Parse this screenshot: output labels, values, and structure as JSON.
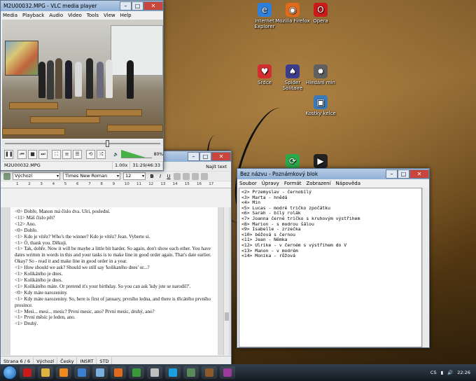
{
  "desktop": {
    "icons": [
      {
        "label": "Internet Explorer",
        "color": "#2f7fd8",
        "glyph": "e"
      },
      {
        "label": "Mozilla Firefox",
        "color": "#e06a1c",
        "glyph": "◉"
      },
      {
        "label": "Opera",
        "color": "#cc1a1a",
        "glyph": "O"
      },
      {
        "label": "Srdce",
        "color": "#d23030",
        "glyph": "♥"
      },
      {
        "label": "Spider Solitaire",
        "color": "#3c3c8c",
        "glyph": "♠"
      },
      {
        "label": "Hledání min",
        "color": "#606060",
        "glyph": "✹"
      },
      {
        "label": "Kostky kelce",
        "color": "#3a7ab8",
        "glyph": "▣"
      },
      {
        "label": "",
        "color": "#2aa84a",
        "glyph": "⟳"
      },
      {
        "label": "",
        "color": "#222222",
        "glyph": "▶"
      }
    ]
  },
  "vlc": {
    "title": "M2U00032.MPG - VLC media player",
    "menu": [
      "Media",
      "Playback",
      "Audio",
      "Video",
      "Tools",
      "View",
      "Help"
    ],
    "seek_position": 0.66,
    "volume_label": "80%",
    "volume_level": 0.8,
    "status_file": "M2U00032.MPG",
    "status_speed": "1.00x",
    "status_time": "31:29/46:33"
  },
  "writer": {
    "find_label": "Najít text",
    "paragraph_style": "Výchozí",
    "font_name": "Times New Roman",
    "font_size": "12",
    "ruler_marks": [
      "1",
      "2",
      "3",
      "4",
      "5",
      "6",
      "7",
      "8",
      "9",
      "10",
      "11",
      "12",
      "13",
      "14",
      "15",
      "16",
      "17"
    ],
    "lines": [
      "<0> Dobře, Manon má číslo dva. Ulri, poslední.",
      "<11> Máš číslo pět?",
      "<12> Ano.",
      "<0> Dobře.",
      "<1> Kdo je vítěz? Who's the winner? Kdo je vítěz? Jean. Vyberte si.",
      "<1> Ó, thank you. Děkuji.",
      "<1> Tak, dobře. Now it will be maybe a little bit harder. So again, don't show each other. You have dates written in words in this and your tasks is to make line in good order again. That's date earlier. Okay? So - read it and make line in good order in a year.",
      "<1> How should we ask? Should we still say 'kolikatého dnes' or...?",
      "<1> Kolikátého je dnes.",
      "<1> Kolikátého je dnes.",
      "<1> Kolikátého máte. Or pretend it's your birthday. So you can ask 'kdy jste se narodil?'.",
      "<0> Kdy máte narozeniny.",
      "<1> Kdy máte narozeniny. So, here is first of january, prvního ledna, and there is třicátého prvního prosince.",
      "<1> Mesi... mesi... mesic? První mesic, ano? První mesic, druhý, ano?",
      "<1> První měsíc je leden, ano.",
      "<1> Druhý."
    ],
    "status": [
      "Strana 6 / 6",
      "Výchozí",
      "Česky",
      "INSRT",
      "STD"
    ]
  },
  "notepad": {
    "title": "Bez názvu - Poznámkový blok",
    "menu": [
      "Soubor",
      "Úpravy",
      "Formát",
      "Zobrazení",
      "Nápověda"
    ],
    "lines": [
      "<2> Przemyslav - černobílý",
      "<3> Marta - hnědá",
      "<4> Min",
      "<5> Lucas - modré tričko zpočátku",
      "<6> Sarah - bílý rolák",
      "<7> Joanna černé tričko s kruhovým výstřihem",
      "<8> Marion - s modrou šálou",
      "<9> Isabelle - zrzečka",
      "<10> béžová s černou",
      "<11> Jean - Němka",
      "<12> Ulrike - v černém s výstřihem do V",
      "<13> Manon - v modrém",
      "<14> Monika - růžová"
    ]
  },
  "taskbar": {
    "apps": [
      {
        "name": "opera",
        "color": "#cc1a1a"
      },
      {
        "name": "explorer",
        "color": "#e0b340"
      },
      {
        "name": "vlc",
        "color": "#f08a1c"
      },
      {
        "name": "writer",
        "color": "#3d7fcf"
      },
      {
        "name": "notepad",
        "color": "#7ab0e0"
      },
      {
        "name": "firefox",
        "color": "#e06a1c"
      },
      {
        "name": "media",
        "color": "#3a9a3a"
      },
      {
        "name": "mail",
        "color": "#c0c0c0"
      },
      {
        "name": "skype",
        "color": "#1aa0e0"
      },
      {
        "name": "calc",
        "color": "#5a8a5a"
      },
      {
        "name": "game",
        "color": "#8a5a2a"
      },
      {
        "name": "other",
        "color": "#9a3a9a"
      }
    ],
    "language": "CS",
    "clock": "22:26"
  }
}
